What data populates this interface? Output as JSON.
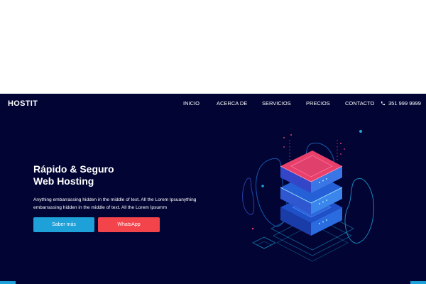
{
  "brand": "HOSTIT",
  "nav": {
    "items": [
      {
        "label": "INICIO"
      },
      {
        "label": "ACERCA DE"
      },
      {
        "label": "SERVICIOS"
      },
      {
        "label": "PRECIOS"
      },
      {
        "label": "CONTACTO"
      }
    ],
    "phone": "351 999 9999"
  },
  "hero": {
    "title_line1": "Rápido & Seguro",
    "title_line2": "Web Hosting",
    "description": "Anything embarrassing hidden in the middle of text. All the Lorem Ipsuanything embarrassing hidden in the middle of text. All the Lorem Ipsumm",
    "primary_button": "Saber más",
    "secondary_button": "WhatsApp"
  },
  "colors": {
    "background": "#020433",
    "primary": "#1da1d8",
    "danger": "#f3434b",
    "server_top": "#e8406b",
    "server_body": "#2a6be0"
  }
}
